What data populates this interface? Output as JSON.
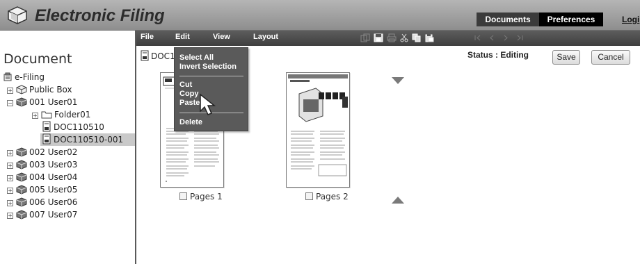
{
  "header": {
    "title": "Electronic Filing",
    "tabs": [
      {
        "label": "Documents",
        "active": true
      },
      {
        "label": "Preferences",
        "active": false
      }
    ],
    "login_label": "Logi"
  },
  "left_pane": {
    "title": "Document",
    "tree": [
      {
        "label": "e-Filing",
        "icon": "efiling-icon",
        "expander": ""
      },
      {
        "label": "Public Box",
        "icon": "box-icon",
        "expander": "+"
      },
      {
        "label": "001 User01",
        "icon": "user-box-icon",
        "expander": "−"
      },
      {
        "label": "Folder01",
        "icon": "folder-icon",
        "expander": "+"
      },
      {
        "label": "DOC110510",
        "icon": "document-icon",
        "expander": ""
      },
      {
        "label": "DOC110510-001",
        "icon": "document-icon",
        "expander": "",
        "selected": true
      },
      {
        "label": "002 User02",
        "icon": "user-box-icon",
        "expander": "+"
      },
      {
        "label": "003 User03",
        "icon": "user-box-icon",
        "expander": "+"
      },
      {
        "label": "004 User04",
        "icon": "user-box-icon",
        "expander": "+"
      },
      {
        "label": "005 User05",
        "icon": "user-box-icon",
        "expander": "+"
      },
      {
        "label": "006 User06",
        "icon": "user-box-icon",
        "expander": "+"
      },
      {
        "label": "007 User07",
        "icon": "user-box-icon",
        "expander": "+"
      }
    ]
  },
  "menubar": {
    "items": [
      "File",
      "Edit",
      "View",
      "Layout"
    ],
    "toolbar_icons": [
      "copy-pages-icon",
      "save-icon",
      "print-icon",
      "cut-icon",
      "copy-icon",
      "paste-icon"
    ],
    "nav_icons": [
      "first-page-icon",
      "previous-page-icon",
      "next-page-icon",
      "last-page-icon"
    ]
  },
  "main": {
    "document_name": "DOC1",
    "status": "Status : Editing",
    "save_label": "Save",
    "cancel_label": "Cancel",
    "pages": [
      {
        "label": "Pages 1",
        "checked": false
      },
      {
        "label": "Pages 2",
        "checked": false
      }
    ]
  },
  "context_menu": {
    "items": [
      "Select All",
      "Invert Selection",
      "Cut",
      "Copy",
      "Paste",
      "Delete"
    ]
  },
  "colors": {
    "header_bg": "#9e9e9e",
    "menubar_bg": "#4a4a4a",
    "context_menu_bg": "#5a5a5a",
    "selected_row": "#c9c9c9"
  }
}
